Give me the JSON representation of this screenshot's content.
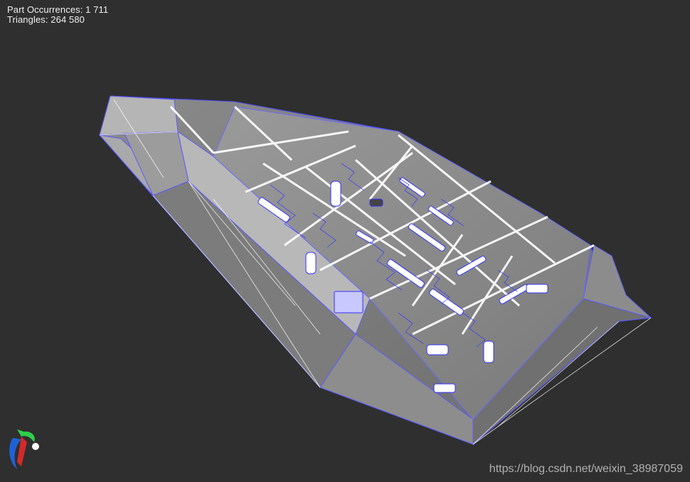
{
  "stats": {
    "part_occurrences": "Part Occurrences: 1 711",
    "triangles": "Triangles: 264 580"
  },
  "watermark": "https://blog.csdn.net/weixin_38987059",
  "model": {
    "render_mode": "shaded-with-edges",
    "surface_color": "#7e7e7e",
    "edge_color": "#3a3aff",
    "highlight_color": "#ffffff",
    "background_color": "#2f2f2f"
  },
  "axis_gizmo": {
    "icon": "axis-orientation-icon",
    "colors": [
      "#1e62d8",
      "#2fcf4a",
      "#d22a2a",
      "#ffffff"
    ]
  }
}
